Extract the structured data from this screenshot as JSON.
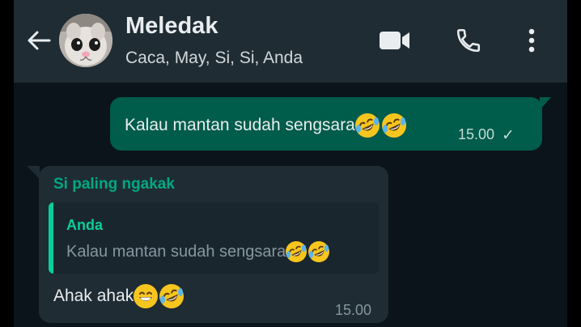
{
  "header": {
    "title": "Meledak",
    "subtitle": "Caca, May, Si, Si, Anda",
    "back_icon": "arrow-left-icon",
    "avatar": "group-avatar-cat",
    "actions": [
      "video-call-icon",
      "voice-call-icon",
      "more-options-icon"
    ]
  },
  "messages": {
    "outgoing": {
      "text": "Kalau mantan sudah sengsara",
      "emojis": [
        "rolling-on-floor-laughing-emoji",
        "rolling-on-floor-laughing-emoji"
      ],
      "time": "15.00",
      "status": "✓"
    },
    "incoming": {
      "sender": "Si paling ngakak",
      "quote": {
        "author": "Anda",
        "text": "Kalau mantan sudah sengsara",
        "emojis": [
          "rolling-on-floor-laughing-emoji",
          "rolling-on-floor-laughing-emoji"
        ]
      },
      "text": "Ahak ahak",
      "emojis": [
        "grinning-face-emoji",
        "rolling-on-floor-laughing-emoji"
      ],
      "time": "15.00"
    }
  },
  "colors": {
    "background": "#0b141a",
    "header": "#1f2c33",
    "outgoing_bubble": "#005c4b",
    "incoming_bubble": "#1f2c33",
    "accent": "#00a884"
  }
}
